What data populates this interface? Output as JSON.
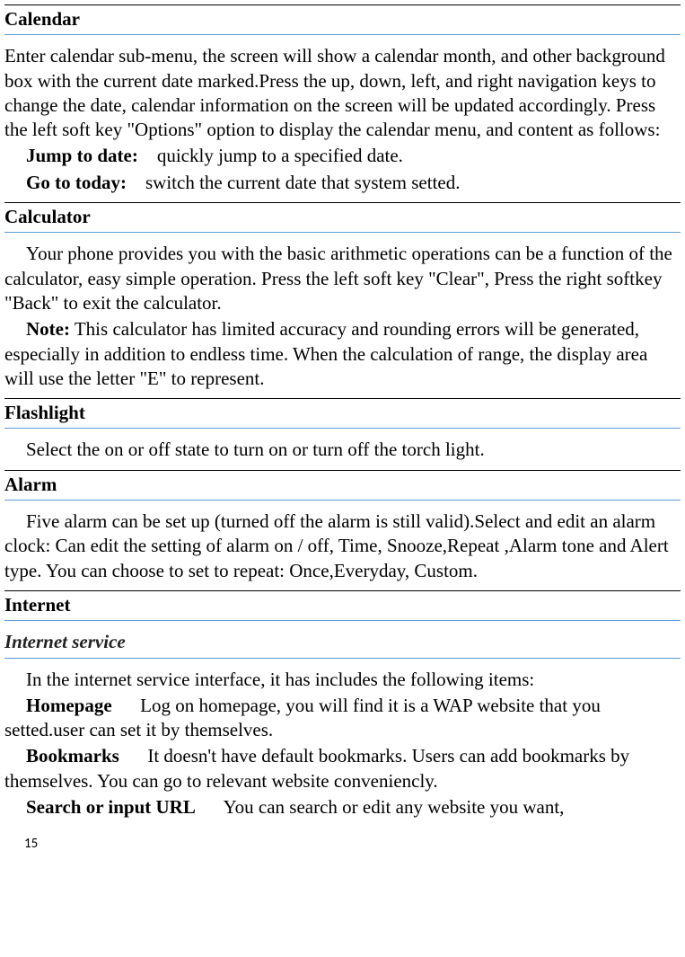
{
  "sections": {
    "calendar": {
      "heading": "Calendar",
      "body": "Enter calendar sub-menu, the screen will show a calendar month, and other background box with the current date marked.Press the up, down, left, and right navigation keys to change the date, calendar information on the screen will be updated accordingly. Press the left soft key \"Options\" option to display the calendar menu, and content as follows:",
      "jump_label": "Jump to date:",
      "jump_text": "    quickly jump to a specified date.",
      "goto_label": "Go to today:",
      "goto_text": "    switch the current date that system setted."
    },
    "calculator": {
      "heading": "Calculator",
      "body": "Your phone provides you with the basic arithmetic operations can be a function of the calculator, easy simple operation. Press the left soft key \"Clear\", Press the right softkey \"Back\" to exit the calculator.",
      "note_label": "Note:",
      "note_text": " This calculator has limited accuracy and rounding errors will be generated, especially in addition to endless time. When the calculation of range, the display area will use the letter \"E\" to represent."
    },
    "flashlight": {
      "heading": "Flashlight",
      "body": "Select the on or off state to turn on or turn off the torch light."
    },
    "alarm": {
      "heading": "Alarm",
      "body": "Five alarm can be set up (turned off the alarm is still valid).Select and edit an alarm clock: Can edit the setting of alarm on / off, Time, Snooze,Repeat ,Alarm tone and Alert type. You can choose to set to repeat: Once,Everyday, Custom."
    },
    "internet": {
      "heading": "Internet",
      "sub_heading": "Internet service",
      "body": "In the internet service interface, it has includes the following items:",
      "homepage_label": "Homepage",
      "homepage_text": "      Log on homepage, you will find it is a WAP website that you setted.user can set it by themselves.",
      "bookmarks_label": "Bookmarks",
      "bookmarks_text": "      It doesn't have default bookmarks. Users can add bookmarks by themselves. You can go to relevant website conveniencly.",
      "search_label": "Search or input URL",
      "search_text": "      You can search or edit any website you want,"
    }
  },
  "page_number": "15"
}
